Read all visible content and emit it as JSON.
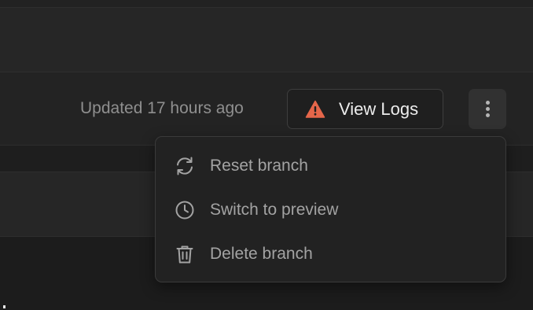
{
  "row": {
    "updated_text": "Updated 17 hours ago",
    "view_logs_label": "View Logs",
    "view_logs_icon": "warning-triangle-icon",
    "warning_color": "#e5664a",
    "more_icon": "vertical-ellipsis-icon"
  },
  "menu": {
    "items": [
      {
        "label": "Reset branch",
        "icon": "refresh-icon"
      },
      {
        "label": "Switch to preview",
        "icon": "clock-icon"
      },
      {
        "label": "Delete branch",
        "icon": "trash-icon"
      }
    ]
  }
}
